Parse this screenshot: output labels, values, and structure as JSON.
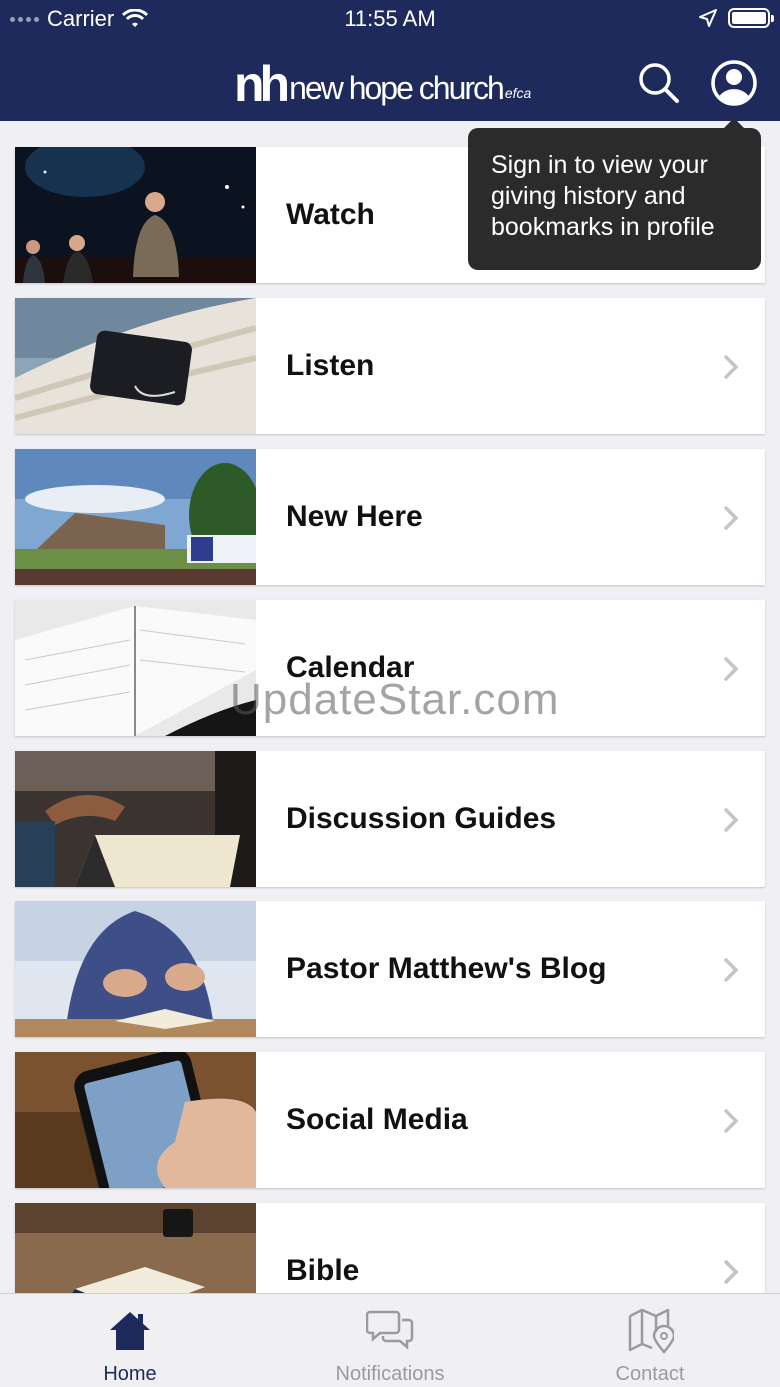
{
  "status": {
    "carrier": "Carrier",
    "time": "11:55 AM"
  },
  "header": {
    "logo_mark": "nh",
    "logo_name": "new hope church",
    "logo_suffix": "efca"
  },
  "tooltip": {
    "text": "Sign in to view your giving history and bookmarks in profile"
  },
  "menu": {
    "items": [
      {
        "label": "Watch"
      },
      {
        "label": "Listen"
      },
      {
        "label": "New Here"
      },
      {
        "label": "Calendar"
      },
      {
        "label": "Discussion Guides"
      },
      {
        "label": "Pastor Matthew's Blog"
      },
      {
        "label": "Social Media"
      },
      {
        "label": "Bible"
      }
    ]
  },
  "tabs": [
    {
      "label": "Home",
      "icon": "home-icon",
      "active": true
    },
    {
      "label": "Notifications",
      "icon": "chat-bubbles-icon",
      "active": false
    },
    {
      "label": "Contact",
      "icon": "map-pin-icon",
      "active": false
    }
  ],
  "watermark": "UpdateStar.com",
  "colors": {
    "header": "#1e2a5c",
    "tab_active": "#1e2a5c",
    "tab_inactive": "#9a9aa0",
    "tooltip": "#2b2b2b"
  }
}
